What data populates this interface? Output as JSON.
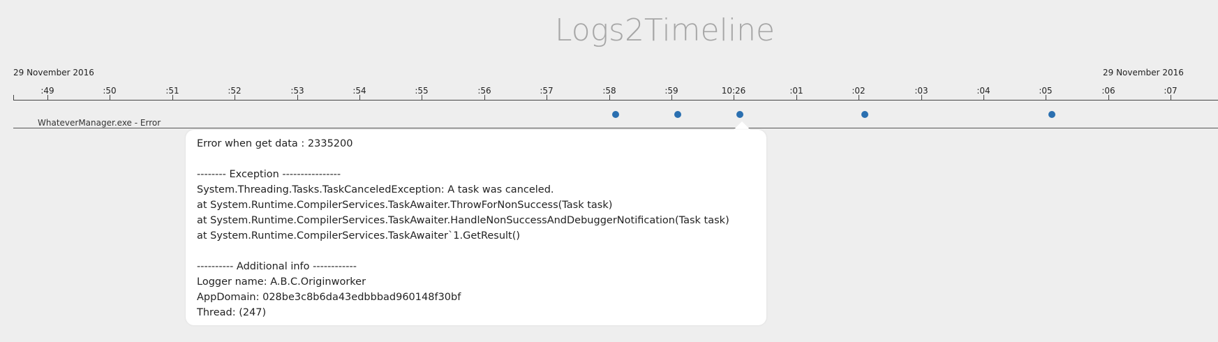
{
  "app": {
    "title": "Logs2Timeline"
  },
  "timeline": {
    "start_date": "29 November 2016",
    "end_date": "29 November 2016",
    "ticks": [
      ":49",
      ":50",
      ":51",
      ":52",
      ":53",
      ":54",
      ":55",
      ":56",
      ":57",
      ":58",
      ":59",
      "10:26",
      ":01",
      ":02",
      ":03",
      ":04",
      ":05",
      ":06",
      ":07"
    ]
  },
  "lane": {
    "label": "WhateverManager.exe - Error"
  },
  "events": [
    {
      "time": "10:25:58.1"
    },
    {
      "time": "10:25:59.1"
    },
    {
      "time": "10:26:00.1"
    },
    {
      "time": "10:26:02.1"
    },
    {
      "time": "10:26:05.1"
    }
  ],
  "tooltip": {
    "lines": [
      "Error when get data : 2335200",
      "",
      "-------- Exception ----------------",
      "System.Threading.Tasks.TaskCanceledException: A task was canceled.",
      "at System.Runtime.CompilerServices.TaskAwaiter.ThrowForNonSuccess(Task task)",
      "at System.Runtime.CompilerServices.TaskAwaiter.HandleNonSuccessAndDebuggerNotification(Task task)",
      "at System.Runtime.CompilerServices.TaskAwaiter`1.GetResult()",
      "",
      "---------- Additional info ------------",
      "Logger name: A.B.C.Originworker",
      "AppDomain: 028be3c8b6da43edbbbad960148f30bf",
      "Thread: (247)"
    ]
  },
  "colors": {
    "event_dot": "#2a6fb0",
    "title": "#a6a6a6",
    "background": "#eeeeee"
  }
}
